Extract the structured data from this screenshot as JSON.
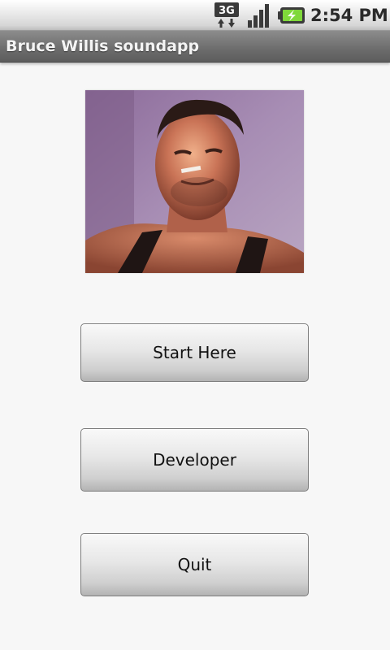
{
  "status_bar": {
    "network_icon": "3g-data-icon",
    "network_label": "3G",
    "signal_icon": "signal-strength-icon",
    "battery_icon": "battery-charging-icon",
    "time": "2:54 PM"
  },
  "app": {
    "title": "Bruce Willis soundapp"
  },
  "main": {
    "portrait_icon": "bruce-willis-portrait-image",
    "buttons": [
      {
        "label": "Start Here"
      },
      {
        "label": "Developer"
      },
      {
        "label": "Quit"
      }
    ]
  }
}
